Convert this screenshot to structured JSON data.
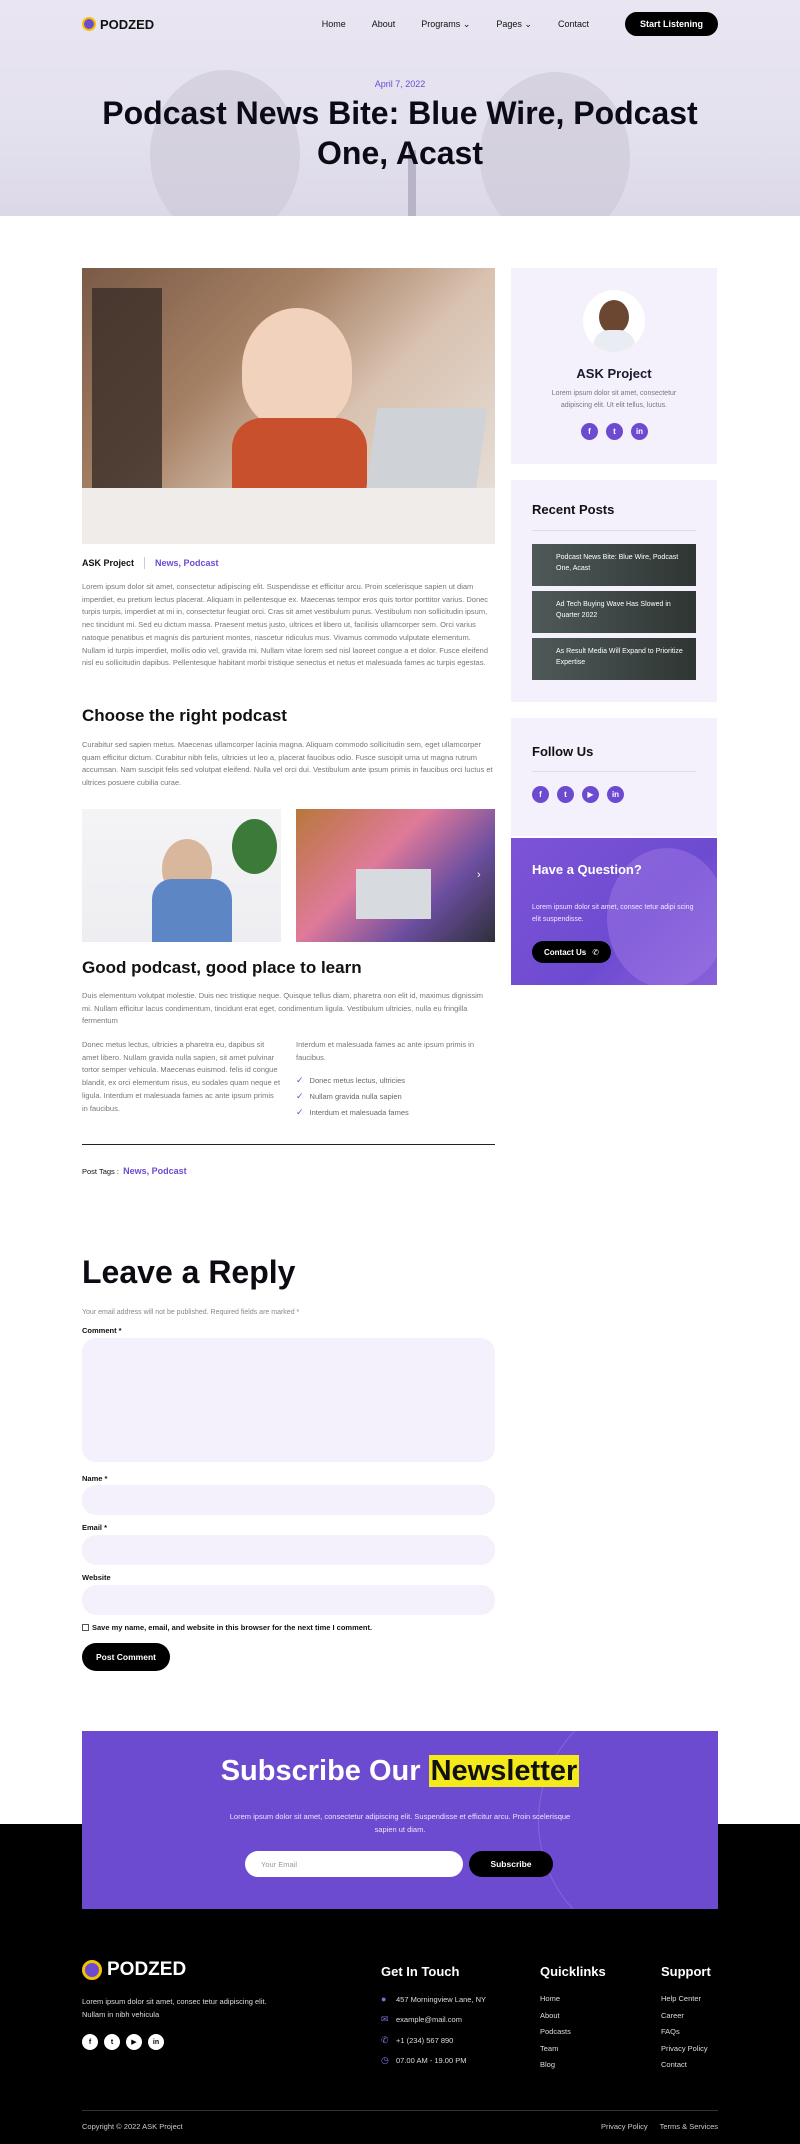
{
  "header": {
    "logo": "PODZED",
    "nav": [
      "Home",
      "About",
      "Programs",
      "Pages",
      "Contact"
    ],
    "cta": "Start Listening"
  },
  "hero": {
    "date": "April 7, 2022",
    "title": "Podcast News Bite: Blue Wire, Podcast One, Acast"
  },
  "post": {
    "author": "ASK Project",
    "categories": "News, Podcast",
    "intro": "Lorem ipsum dolor sit amet, consectetur adipiscing elit. Suspendisse et efficitur arcu. Proin scelerisque sapien ut diam imperdiet, eu pretium lectus placerat. Aliquam in pellentesque ex. Maecenas tempor eros quis tortor porttitor varius. Donec turpis turpis, imperdiet at mi in, consectetur feugiat orci. Cras sit amet vestibulum purus. Vestibulum non sollicitudin ipsum, nec tincidunt mi. Sed eu dictum massa. Praesent metus justo, ultrices et libero ut, facilisis ullamcorper sem. Orci varius natoque penatibus et magnis dis parturient montes, nascetur ridiculus mus. Vivamus commodo vulputate elementum. Nullam id turpis imperdiet, mollis odio vel, gravida mi. Nullam vitae lorem sed nisl laoreet congue a et dolor. Fusce eleifend nisl eu sollicitudin dapibus. Pellentesque habitant morbi tristique senectus et netus et malesuada fames ac turpis egestas.",
    "h2a": "Choose the right podcast",
    "para2": "Curabitur sed sapien metus. Maecenas ullamcorper lacinia magna. Aliquam commodo sollicitudin sem, eget ullamcorper quam efficitur dictum. Curabitur nibh felis, ultricies ut leo a, placerat faucibus odio. Fusce suscipit urna ut magna rutrum accumsan. Nam suscipit felis sed volutpat eleifend. Nulla vel orci dui. Vestibulum ante ipsum primis in faucibus orci luctus et ultrices posuere cubilia curae.",
    "h2b": "Good podcast, good place to learn",
    "para3": "Duis elementum volutpat molestie. Duis nec tristique neque. Quisque tellus diam, pharetra non elit id, maximus dignissim mi. Nullam efficitur lacus condimentum, tincidunt erat eget, condimentum ligula. Vestibulum ultricies, nulla eu fringilla fermentum",
    "col_left": "Donec metus lectus, ultricies a pharetra eu, dapibus sit amet libero. Nullam gravida nulla sapien, sit amet pulvinar tortor semper vehicula. Maecenas euismod. felis id congue blandit, ex orci elementum risus, eu sodales quam neque et ligula. Interdum et malesuada fames ac ante ipsum primis in faucibus.",
    "col_right": "Interdum et malesuada fames ac ante ipsum primis in faucibus.",
    "checklist": [
      "Donec metus lectus, ultricies",
      "Nullam gravida nulla sapien",
      "Interdum et malesuada fames"
    ],
    "tags_label": "Post Tags :",
    "tags": "News, Podcast"
  },
  "reply": {
    "title": "Leave a Reply",
    "note": "Your email address will not be published. Required fields are marked *",
    "comment_label": "Comment *",
    "name_label": "Name *",
    "email_label": "Email *",
    "website_label": "Website",
    "save_label": "Save my name, email, and website in this browser for the next time I comment.",
    "submit": "Post Comment"
  },
  "sidebar": {
    "author_name": "ASK Project",
    "author_bio": "Lorem ipsum dolor sit amet, consectetur adipiscing elit. Ut elit tellus, luctus.",
    "recent_title": "Recent Posts",
    "recent_posts": [
      "Podcast News Bite: Blue Wire, Podcast One, Acast",
      "Ad Tech Buying Wave Has Slowed in Quarter 2022",
      "As Result Media Will Expand to Prioritize Expertise"
    ],
    "follow_title": "Follow Us",
    "question_title": "Have a Question?",
    "question_text": "Lorem ipsum dolor sit amet, consec tetur adipi scing elit suspendisse.",
    "contact_btn": "Contact Us"
  },
  "newsletter": {
    "title_a": "Subscribe Our",
    "title_b": "Newsletter",
    "text": "Lorem ipsum dolor sit amet, consectetur adipiscing elit. Suspendisse et efficitur arcu. Proin scelerisque sapien ut diam.",
    "placeholder": "Your Email",
    "button": "Subscribe"
  },
  "footer": {
    "logo": "PODZED",
    "about": "Lorem ipsum dolor sit amet, consec tetur adipiscing elit. Nullam in nibh vehicula",
    "contact_title": "Get In Touch",
    "address": "457 Morningview Lane, NY",
    "email": "example@mail.com",
    "phone": "+1 (234) 567 890",
    "hours": "07.00 AM - 19.00 PM",
    "quick_title": "Quicklinks",
    "quick": [
      "Home",
      "About",
      "Podcasts",
      "Team",
      "Blog"
    ],
    "support_title": "Support",
    "support": [
      "Help Center",
      "Career",
      "FAQs",
      "Privacy Policy",
      "Contact"
    ],
    "copyright": "Copyright © 2022 ASK Project",
    "legal": [
      "Privacy Policy",
      "Terms & Services"
    ]
  }
}
